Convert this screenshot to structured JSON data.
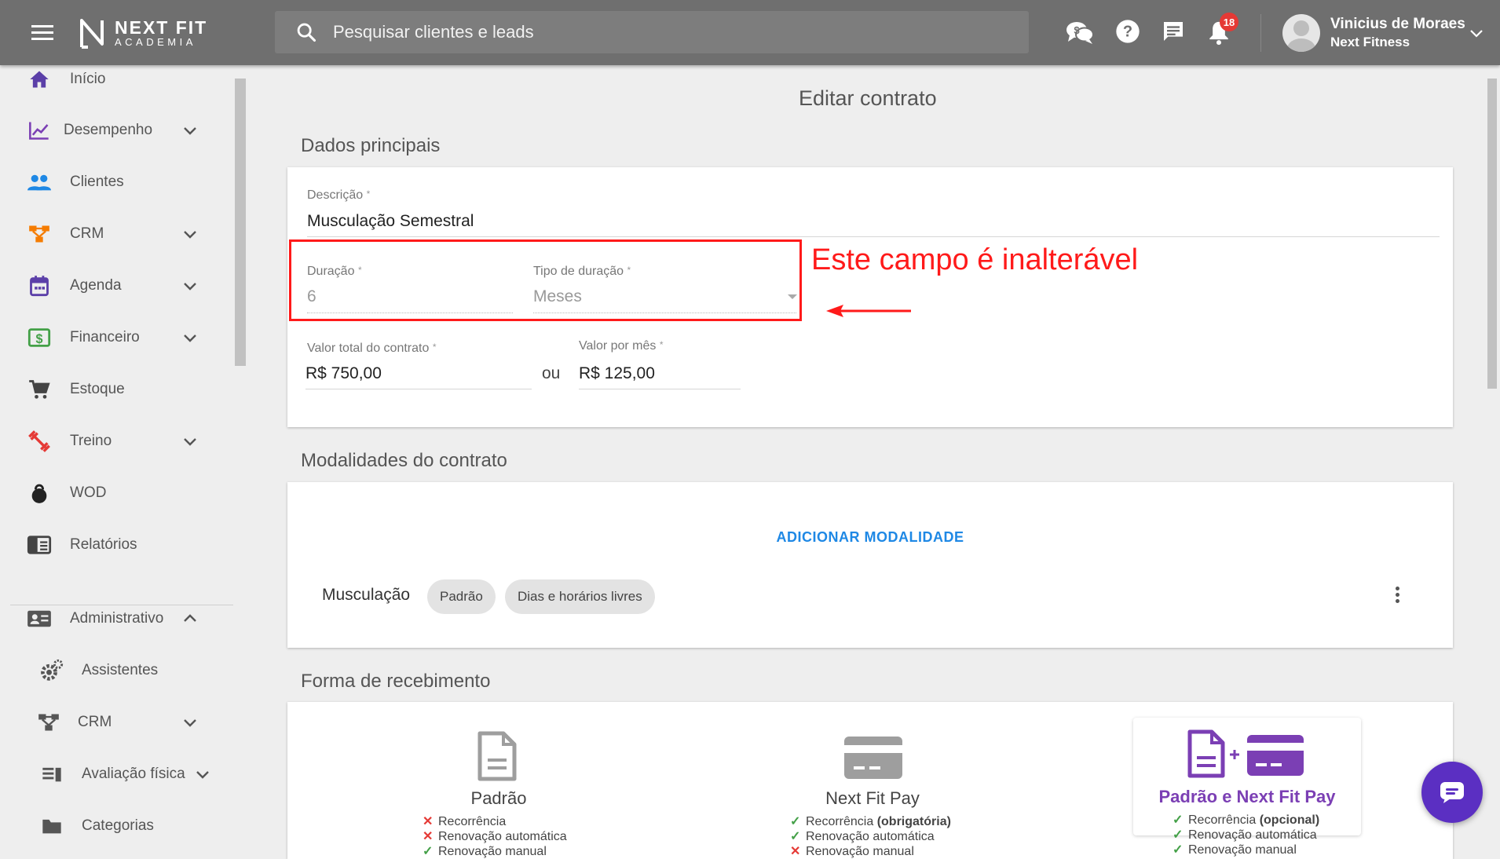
{
  "app": {
    "logo_line1": "NEXT FIT",
    "logo_line2": "ACADEMIA",
    "search_placeholder": "Pesquisar clientes e leads",
    "notification_count": "18",
    "user_name": "Vinicius de Moraes",
    "user_org": "Next Fitness"
  },
  "sidebar": {
    "items": [
      {
        "label": "Início",
        "icon": "home-icon",
        "color": "#5b3fa8"
      },
      {
        "label": "Desempenho",
        "icon": "trending-up-icon",
        "color": "#7b3fb4"
      },
      {
        "label": "Clientes",
        "icon": "people-icon",
        "color": "#1e88e5"
      },
      {
        "label": "CRM",
        "icon": "crm-flow-icon",
        "color": "#f57c00"
      },
      {
        "label": "Agenda",
        "icon": "calendar-icon",
        "color": "#5b3fa8"
      },
      {
        "label": "Financeiro",
        "icon": "dollar-icon",
        "color": "#43a047"
      },
      {
        "label": "Estoque",
        "icon": "cart-icon",
        "color": "#444444"
      },
      {
        "label": "Treino",
        "icon": "dumbbell-icon",
        "color": "#e53935"
      },
      {
        "label": "WOD",
        "icon": "kettlebell-icon",
        "color": "#222222"
      },
      {
        "label": "Relatórios",
        "icon": "report-icon",
        "color": "#444444"
      },
      {
        "label": "Administrativo",
        "icon": "id-card-icon",
        "color": "#555555"
      },
      {
        "label": "Assistentes",
        "icon": "gears-icon",
        "color": "#555555"
      },
      {
        "label": "CRM",
        "icon": "crm-flow-icon",
        "color": "#555555"
      },
      {
        "label": "Avaliação física",
        "icon": "assessment-icon",
        "color": "#555555"
      },
      {
        "label": "Categorias",
        "icon": "folder-icon",
        "color": "#555555"
      }
    ]
  },
  "page": {
    "title": "Editar contrato",
    "sections": {
      "main_data": "Dados principais",
      "modalities": "Modalidades do contrato",
      "payment": "Forma de recebimento"
    },
    "fields": {
      "description_label": "Descrição",
      "description_value": "Musculação Semestral",
      "duration_label": "Duração",
      "duration_value": "6",
      "duration_type_label": "Tipo de duração",
      "duration_type_value": "Meses",
      "total_label": "Valor total do contrato",
      "total_value": "R$ 750,00",
      "or_label": "ou",
      "monthly_label": "Valor por mês",
      "monthly_value": "R$ 125,00",
      "required_mark": "*"
    },
    "annotation": "Este campo é inalterável",
    "modalities": {
      "add_label": "ADICIONAR MODALIDADE",
      "row_name": "Musculação",
      "chips": [
        "Padrão",
        "Dias e horários livres"
      ]
    },
    "payment": {
      "options": [
        {
          "title": "Padrão",
          "lines": [
            {
              "mark": "✕",
              "text": "Recorrência",
              "extra": ""
            },
            {
              "mark": "✕",
              "text": "Renovação automática",
              "extra": ""
            },
            {
              "mark": "✓",
              "text": "Renovação manual",
              "extra": ""
            }
          ]
        },
        {
          "title": "Next Fit Pay",
          "lines": [
            {
              "mark": "✓",
              "text": "Recorrência ",
              "extra": "(obrigatória)"
            },
            {
              "mark": "✓",
              "text": "Renovação automática",
              "extra": ""
            },
            {
              "mark": "✕",
              "text": "Renovação manual",
              "extra": ""
            }
          ]
        },
        {
          "title": "Padrão e Next Fit Pay",
          "lines": [
            {
              "mark": "✓",
              "text": "Recorrência ",
              "extra": "(opcional)"
            },
            {
              "mark": "✓",
              "text": "Renovação automática",
              "extra": ""
            },
            {
              "mark": "✓",
              "text": "Renovação manual",
              "extra": ""
            }
          ]
        }
      ]
    }
  }
}
